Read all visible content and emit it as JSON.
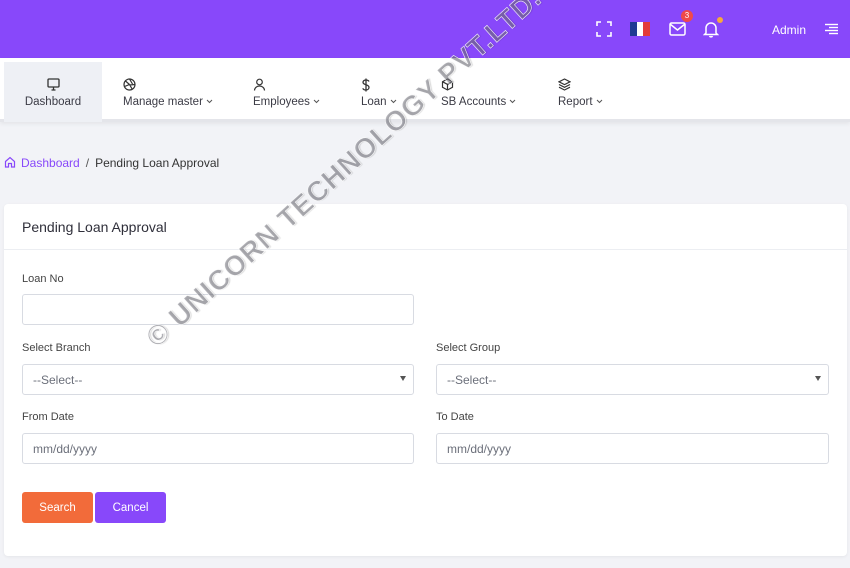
{
  "topbar": {
    "mail_badge": "3",
    "admin_label": "Admin",
    "colors": {
      "background": "#8848fa",
      "badge": "#ef4a4a",
      "dot": "#f7a93b"
    },
    "icons": [
      "fullscreen-icon",
      "france-flag-icon",
      "mail-icon",
      "bell-icon",
      "menu-icon"
    ]
  },
  "nav": {
    "items": [
      {
        "label": "Dashboard",
        "icon": "monitor-icon"
      },
      {
        "label": "Manage master",
        "icon": "aperture-icon"
      },
      {
        "label": "Employees",
        "icon": "user-icon"
      },
      {
        "label": "Loan",
        "icon": "dollar-icon"
      },
      {
        "label": "SB Accounts",
        "icon": "box-icon"
      },
      {
        "label": "Report",
        "icon": "layers-icon"
      }
    ]
  },
  "breadcrumb": {
    "home": "Dashboard",
    "separator": "/",
    "current": "Pending Loan Approval"
  },
  "form": {
    "title": "Pending Loan Approval",
    "loan_no_label": "Loan No",
    "loan_no_value": "",
    "branch_label": "Select Branch",
    "branch_value": "--Select--",
    "group_label": "Select Group",
    "group_value": "--Select--",
    "from_date_label": "From Date",
    "from_date_placeholder": "mm/dd/yyyy",
    "to_date_label": "To Date",
    "to_date_placeholder": "mm/dd/yyyy",
    "search_label": "Search",
    "cancel_label": "Cancel"
  },
  "watermark": "© UNICORN TECHNOLOGY PVT.LTD."
}
